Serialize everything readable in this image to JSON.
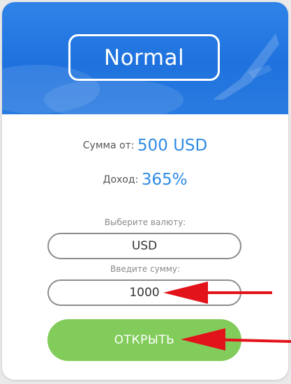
{
  "plan": {
    "name": "Normal"
  },
  "info": {
    "amount_label": "Сумма от:",
    "amount_value": "500 USD",
    "income_label": "Доход:",
    "income_value": "365%"
  },
  "form": {
    "currency_label": "Выберите валюту:",
    "currency_value": "USD",
    "amount_label": "Введите сумму:",
    "amount_value": "1000",
    "submit_label": "ОТКРЫТЬ"
  },
  "colors": {
    "hero": "#1f72de",
    "accent": "#2f8be6",
    "button": "#82cc5b",
    "arrow": "#e3131b"
  }
}
